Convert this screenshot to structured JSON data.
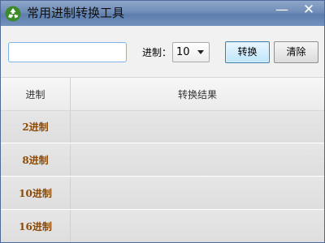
{
  "window": {
    "title": "常用进制转换工具",
    "icon": "recycle-icon",
    "minimize_glyph": "—",
    "close_glyph": "✕",
    "accent_color": "#6f8db8"
  },
  "toolbar": {
    "number_input_value": "",
    "number_input_placeholder": "",
    "base_label": "进制：",
    "base_selected": "10",
    "convert_label": "转换",
    "clear_label": "清除"
  },
  "table": {
    "headers": [
      "进制",
      "转换结果"
    ],
    "rows": [
      {
        "base": "2进制",
        "result": ""
      },
      {
        "base": "8进制",
        "result": ""
      },
      {
        "base": "10进制",
        "result": ""
      },
      {
        "base": "16进制",
        "result": ""
      }
    ],
    "label_color": "#8a4b08"
  }
}
